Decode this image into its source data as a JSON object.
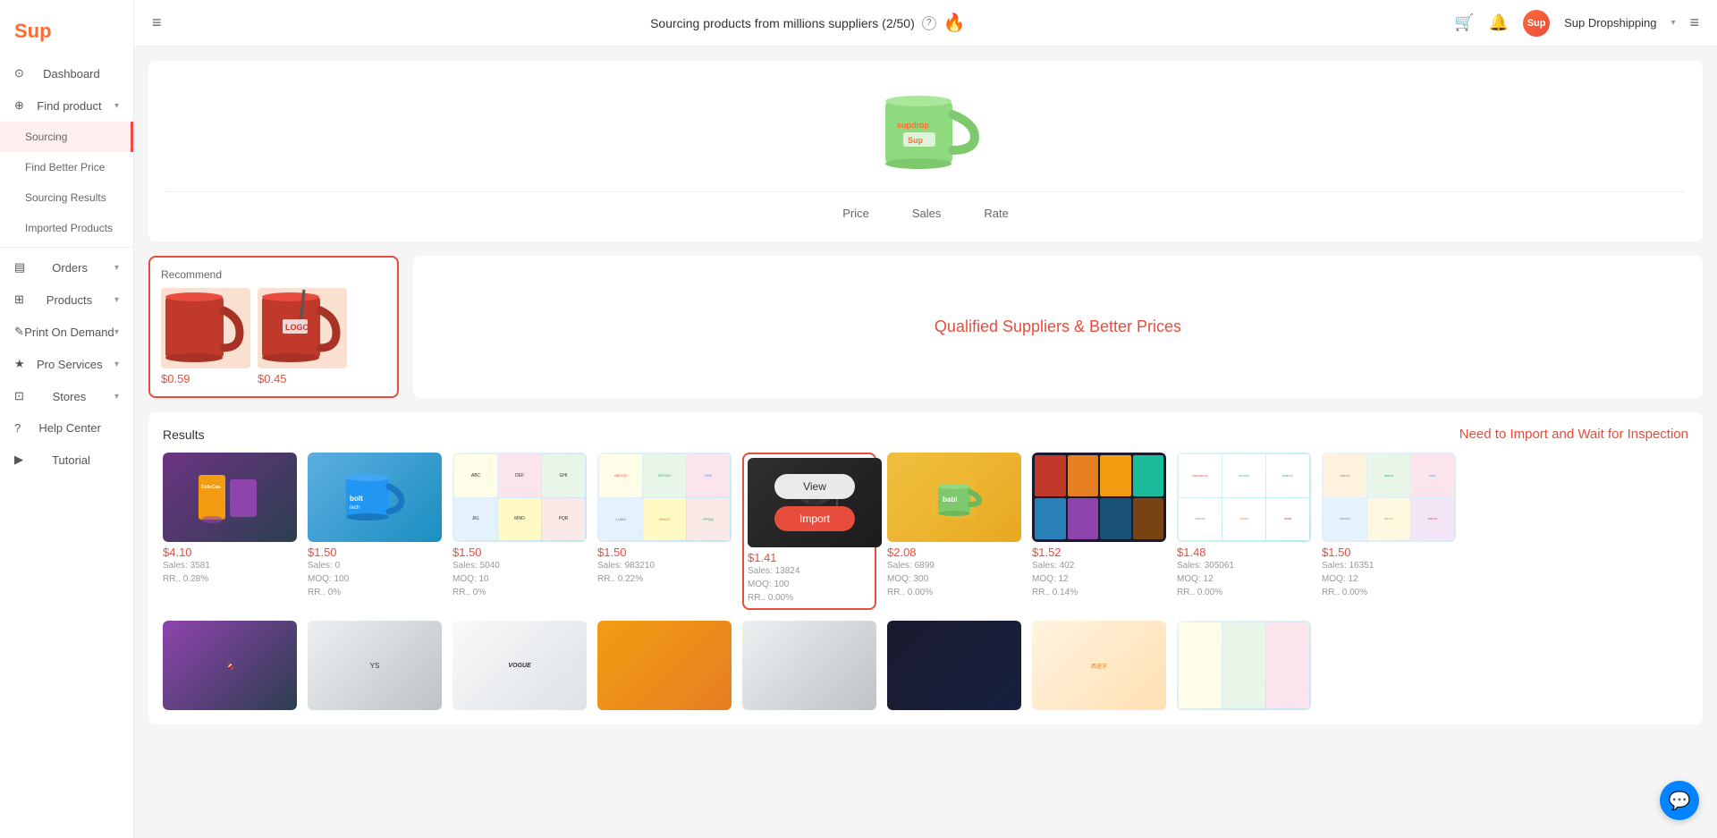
{
  "app": {
    "logo": "Sup",
    "title": "Sourcing"
  },
  "topbar": {
    "sourcing_label": "Sourcing products from millions suppliers (2/50)",
    "help_tooltip": "?",
    "username": "Sup Dropshipping",
    "counter": "2/50"
  },
  "sidebar": {
    "items": [
      {
        "id": "dashboard",
        "label": "Dashboard",
        "icon": "⊙",
        "active": false,
        "indent": false
      },
      {
        "id": "find-product",
        "label": "Find product",
        "icon": "⊕",
        "active": false,
        "indent": false,
        "has_chevron": true
      },
      {
        "id": "sourcing",
        "label": "Sourcing",
        "active": true,
        "indent": true
      },
      {
        "id": "find-better-price",
        "label": "Find Better Price",
        "active": false,
        "indent": true
      },
      {
        "id": "sourcing-results",
        "label": "Sourcing Results",
        "active": false,
        "indent": true
      },
      {
        "id": "imported-products",
        "label": "Imported Products",
        "active": false,
        "indent": true
      },
      {
        "id": "orders",
        "label": "Orders",
        "icon": "▤",
        "active": false,
        "indent": false,
        "has_chevron": true
      },
      {
        "id": "products",
        "label": "Products",
        "icon": "⊞",
        "active": false,
        "indent": false,
        "has_chevron": true
      },
      {
        "id": "print-on-demand",
        "label": "Print On Demand",
        "icon": "✎",
        "active": false,
        "indent": false,
        "has_chevron": true
      },
      {
        "id": "pro-services",
        "label": "Pro Services",
        "icon": "★",
        "active": false,
        "indent": false,
        "has_chevron": true
      },
      {
        "id": "stores",
        "label": "Stores",
        "icon": "⊡",
        "active": false,
        "indent": false,
        "has_chevron": true
      },
      {
        "id": "help-center",
        "label": "Help Center",
        "icon": "?",
        "active": false,
        "indent": false
      },
      {
        "id": "tutorial",
        "label": "Tutorial",
        "icon": "▶",
        "active": false,
        "indent": false
      }
    ]
  },
  "hero": {
    "mug_alt": "Green Supdrop Mug",
    "tabs": [
      {
        "id": "price",
        "label": "Price"
      },
      {
        "id": "sales",
        "label": "Sales"
      },
      {
        "id": "rate",
        "label": "Rate"
      }
    ]
  },
  "recommend": {
    "title": "Recommend",
    "products": [
      {
        "id": "rec1",
        "price": "$0.59",
        "color": "#c0392b"
      },
      {
        "id": "rec2",
        "price": "$0.45",
        "color": "#c0392b"
      }
    ]
  },
  "cta": {
    "text": "Qualified Suppliers & Better Prices"
  },
  "results": {
    "title": "Results",
    "cta_label": "Need to Import and Wait for Inspection",
    "products": [
      {
        "id": "r1",
        "price": "$4.10",
        "sales": "Sales: 3581",
        "rr": "RR.. 0.28%",
        "moq": "",
        "type": "food",
        "colors": [
          "#6c3483",
          "#2c3e50"
        ]
      },
      {
        "id": "r2",
        "price": "$1.50",
        "sales": "Sales: 0",
        "moq": "MOQ: 100",
        "rr": "RR.. 0%",
        "type": "teal_mug",
        "colors": [
          "#1abc9c",
          "#16a085"
        ]
      },
      {
        "id": "r3",
        "price": "$1.50",
        "sales": "Sales: 5040",
        "moq": "MOQ: 10",
        "rr": "RR.. 0%",
        "type": "stickers",
        "colors": []
      },
      {
        "id": "r4",
        "price": "$1.50",
        "sales": "Sales: 983210",
        "moq": "",
        "rr": "RR.. 0.22%",
        "type": "stickers2",
        "colors": []
      },
      {
        "id": "r5",
        "price": "$1.41",
        "sales": "Sales: 13824",
        "moq": "MOQ: 100",
        "rr": "RR.. 0.00%",
        "type": "highlighted",
        "colors": [
          "#555",
          "#333"
        ]
      },
      {
        "id": "r6",
        "price": "$2.08",
        "sales": "Sales: 6899",
        "moq": "MOQ: 300",
        "rr": "RR.. 0.00%",
        "type": "green_mug",
        "colors": [
          "#27ae60",
          "#2ecc71"
        ]
      },
      {
        "id": "r7",
        "price": "$1.52",
        "sales": "Sales: 402",
        "moq": "MOQ: 12",
        "rr": "RR.. 0.14%",
        "type": "multimugs",
        "colors": [
          "#c0392b",
          "#e67e22",
          "#f39c12",
          "#27ae60",
          "#2980b9",
          "#8e44ad",
          "#1a5276",
          "#784212"
        ]
      },
      {
        "id": "r8",
        "price": "$1.48",
        "sales": "Sales: 305061",
        "moq": "MOQ: 12",
        "rr": "RR.. 0.00%",
        "type": "stickers3",
        "colors": []
      },
      {
        "id": "r9",
        "price": "$1.50",
        "sales": "Sales: 16351",
        "moq": "MOQ: 12",
        "rr": "RR.. 0.00%",
        "type": "stickers4",
        "colors": []
      }
    ]
  }
}
